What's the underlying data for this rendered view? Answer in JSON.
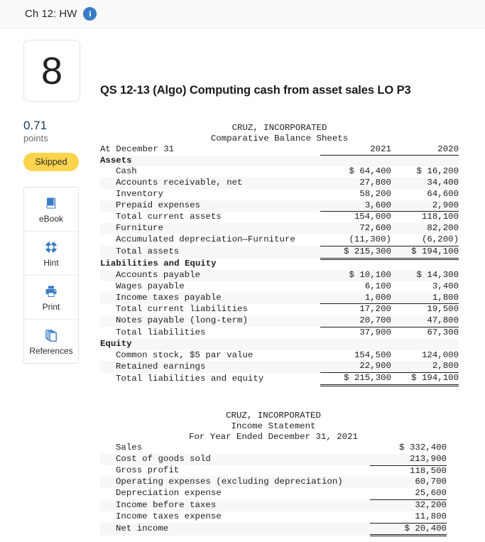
{
  "topbar": {
    "title": "Ch 12: HW",
    "info_icon": "info-icon",
    "info_glyph": "i"
  },
  "rail": {
    "question_number": "8",
    "points_value": "0.71",
    "points_label": "points",
    "status_badge": "Skipped",
    "tools": [
      {
        "label": "eBook",
        "icon": "book-icon"
      },
      {
        "label": "Hint",
        "icon": "lifering-icon"
      },
      {
        "label": "Print",
        "icon": "printer-icon"
      },
      {
        "label": "References",
        "icon": "copy-pages-icon"
      }
    ]
  },
  "main": {
    "question_title": "QS 12-13 (Algo) Computing cash from asset sales LO P3"
  },
  "balance_sheet": {
    "company": "CRUZ, INCORPORATED",
    "statement": "Comparative Balance Sheets",
    "row_label_header": "At December 31",
    "column_headers": [
      "2021",
      "2020"
    ],
    "rows": [
      {
        "label": "Assets",
        "section": true,
        "values": [
          "",
          ""
        ]
      },
      {
        "label": "Cash",
        "values": [
          "$ 64,400",
          "$ 16,200"
        ]
      },
      {
        "label": "Accounts receivable, net",
        "values": [
          "27,800",
          "34,400"
        ]
      },
      {
        "label": "Inventory",
        "values": [
          "58,200",
          "64,600"
        ]
      },
      {
        "label": "Prepaid expenses",
        "values": [
          "3,600",
          "2,900"
        ],
        "rule": "single"
      },
      {
        "label": "Total current assets",
        "values": [
          "154,000",
          "118,100"
        ]
      },
      {
        "label": "Furniture",
        "values": [
          "72,600",
          "82,200"
        ]
      },
      {
        "label": "Accumulated depreciation—Furniture",
        "values": [
          "(11,300)",
          "(6,200)"
        ],
        "rule": "single"
      },
      {
        "label": "Total assets",
        "values": [
          "$ 215,300",
          "$ 194,100"
        ],
        "rule": "double"
      },
      {
        "label": "Liabilities and Equity",
        "section": true,
        "values": [
          "",
          ""
        ]
      },
      {
        "label": "Accounts payable",
        "values": [
          "$ 10,100",
          "$ 14,300"
        ]
      },
      {
        "label": "Wages payable",
        "values": [
          "6,100",
          "3,400"
        ]
      },
      {
        "label": "Income taxes payable",
        "values": [
          "1,000",
          "1,800"
        ],
        "rule": "single"
      },
      {
        "label": "Total current liabilities",
        "values": [
          "17,200",
          "19,500"
        ]
      },
      {
        "label": "Notes payable (long-term)",
        "values": [
          "20,700",
          "47,800"
        ],
        "rule": "single"
      },
      {
        "label": "Total liabilities",
        "values": [
          "37,900",
          "67,300"
        ]
      },
      {
        "label": "Equity",
        "section": true,
        "values": [
          "",
          ""
        ]
      },
      {
        "label": "Common stock, $5 par value",
        "values": [
          "154,500",
          "124,000"
        ]
      },
      {
        "label": "Retained earnings",
        "values": [
          "22,900",
          "2,800"
        ],
        "rule": "single"
      },
      {
        "label": "Total liabilities and equity",
        "values": [
          "$ 215,300",
          "$ 194,100"
        ],
        "rule": "double"
      }
    ]
  },
  "income_statement": {
    "company": "CRUZ, INCORPORATED",
    "statement": "Income Statement",
    "period": "For Year Ended December 31, 2021",
    "rows": [
      {
        "label": "Sales",
        "value": "$ 332,400"
      },
      {
        "label": "Cost of goods sold",
        "value": "213,900",
        "rule": "single"
      },
      {
        "label": "Gross profit",
        "value": "118,500"
      },
      {
        "label": "Operating expenses (excluding depreciation)",
        "value": "60,700"
      },
      {
        "label": "Depreciation expense",
        "value": "25,600",
        "rule": "single"
      },
      {
        "label": "Income before taxes",
        "value": "32,200"
      },
      {
        "label": "Income taxes expense",
        "value": "11,800",
        "rule": "single"
      },
      {
        "label": "Net income",
        "value": "$ 20,400",
        "rule": "double"
      }
    ]
  },
  "colors": {
    "table_header_bg": "#d5dae4",
    "badge_bg": "#fdd44b",
    "accent_blue": "#3b7dc4",
    "points_text": "#1f3864"
  }
}
